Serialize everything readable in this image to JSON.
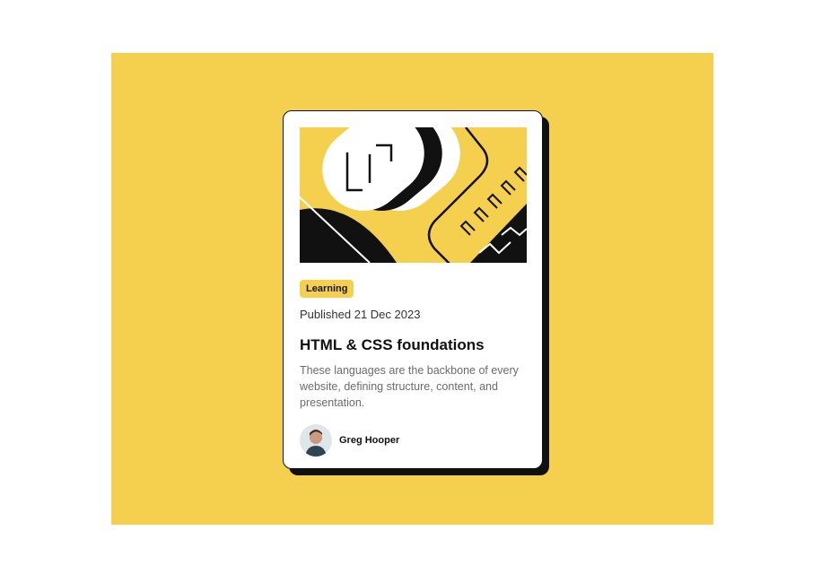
{
  "card": {
    "tag": "Learning",
    "published": "Published 21 Dec 2023",
    "title": "HTML & CSS foundations",
    "description": "These languages are the backbone of every website, defining structure, content, and presentation.",
    "author": "Greg Hooper"
  },
  "colors": {
    "accent": "#f4d04e",
    "ink": "#111111",
    "muted": "#6b6b6b"
  },
  "icons": {
    "hero": "illustration-abstract",
    "avatar": "author-photo"
  }
}
